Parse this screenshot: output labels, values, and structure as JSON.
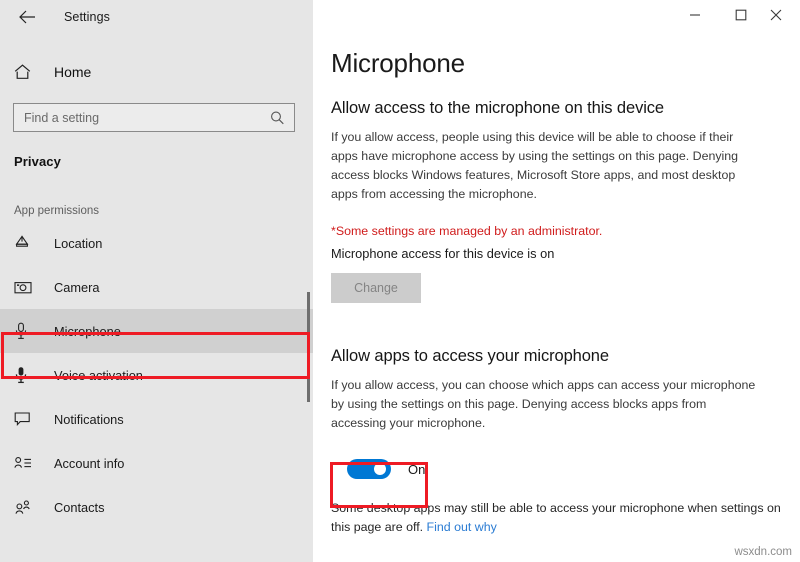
{
  "window": {
    "app_title": "Settings",
    "back_icon": "back-arrow-icon",
    "controls": [
      {
        "name": "minimize",
        "glyph": "–"
      },
      {
        "name": "maximize",
        "glyph": "□"
      },
      {
        "name": "close",
        "glyph": "✕"
      }
    ]
  },
  "sidebar": {
    "home": {
      "label": "Home",
      "icon": "home-icon"
    },
    "search": {
      "placeholder": "Find a setting",
      "value": "",
      "icon": "search-icon"
    },
    "section_title": "Privacy",
    "group_label": "App permissions",
    "items": [
      {
        "label": "Location",
        "icon": "location-pin-icon",
        "selected": false
      },
      {
        "label": "Camera",
        "icon": "camera-icon",
        "selected": false
      },
      {
        "label": "Microphone",
        "icon": "microphone-icon",
        "selected": true
      },
      {
        "label": "Voice activation",
        "icon": "voice-mic-icon",
        "selected": false
      },
      {
        "label": "Notifications",
        "icon": "speech-bubble-icon",
        "selected": false
      },
      {
        "label": "Account info",
        "icon": "account-info-icon",
        "selected": false
      },
      {
        "label": "Contacts",
        "icon": "contacts-icon",
        "selected": false
      }
    ]
  },
  "main": {
    "page_title": "Microphone",
    "device_section": {
      "heading": "Allow access to the microphone on this device",
      "body": "If you allow access, people using this device will be able to choose if their apps have microphone access by using the settings on this page. Denying access blocks Windows features, Microsoft Store apps, and most desktop apps from accessing the microphone.",
      "admin_note": "*Some settings are managed by an administrator.",
      "status": "Microphone access for this device is on",
      "change_button": "Change",
      "change_button_disabled": true
    },
    "apps_section": {
      "heading": "Allow apps to access your microphone",
      "body": "If you allow access, you can choose which apps can access your microphone by using the settings on this page. Denying access blocks apps from accessing your microphone.",
      "toggle_state": "On",
      "toggle_on": true
    },
    "footer": {
      "text": "Some desktop apps may still be able to access your microphone when settings on this page are off.",
      "link": "Find out why"
    }
  },
  "watermark": "wsxdn.com",
  "colors": {
    "sidebar_bg": "#e6e6e6",
    "selected_row": "#d0d0d0",
    "accent_blue": "#0078d4",
    "link_blue": "#2b7cd3",
    "warning_red": "#d01c1c",
    "annotation_red": "#ee1b24"
  }
}
